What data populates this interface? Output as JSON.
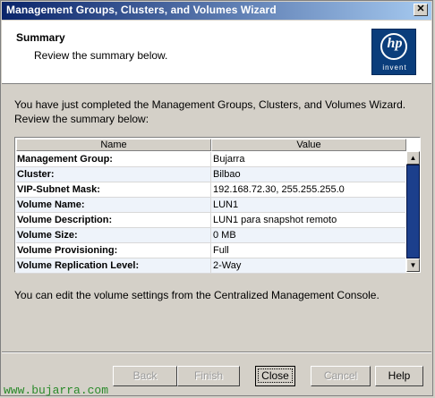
{
  "window": {
    "title": "Management Groups, Clusters, and Volumes Wizard",
    "close_glyph": "✕"
  },
  "header": {
    "title": "Summary",
    "subtitle": "Review the summary below.",
    "logo_text": "hp",
    "logo_tagline": "invent"
  },
  "intro_text": "You have just completed the Management Groups, Clusters, and Volumes Wizard. Review the summary below:",
  "table": {
    "headers": {
      "name": "Name",
      "value": "Value"
    },
    "rows": [
      {
        "name": "Management Group:",
        "value": "Bujarra"
      },
      {
        "name": "Cluster:",
        "value": "Bilbao"
      },
      {
        "name": "VIP-Subnet Mask:",
        "value": "192.168.72.30, 255.255.255.0"
      },
      {
        "name": "Volume Name:",
        "value": "LUN1"
      },
      {
        "name": "Volume Description:",
        "value": "LUN1 para snapshot remoto"
      },
      {
        "name": "Volume Size:",
        "value": "0 MB"
      },
      {
        "name": "Volume Provisioning:",
        "value": "Full"
      },
      {
        "name": "Volume Replication Level:",
        "value": "2-Way"
      }
    ]
  },
  "footer_text": "You can edit the volume settings from the Centralized Management Console.",
  "buttons": {
    "back": "Back",
    "finish": "Finish",
    "close": "Close",
    "cancel": "Cancel",
    "help": "Help"
  },
  "watermark": "www.bujarra.com",
  "colors": {
    "titlebar_start": "#0a246a",
    "titlebar_end": "#a6caf0",
    "logo_bg": "#0a3d7b",
    "scroll_thumb": "#1c3f8c",
    "watermark": "#2a8a2a"
  }
}
